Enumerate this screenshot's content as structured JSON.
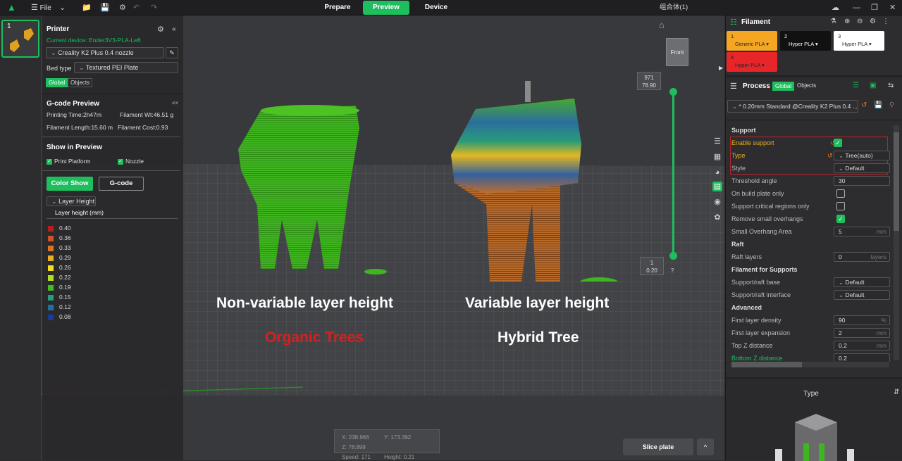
{
  "topbar": {
    "file_label": "File",
    "tabs": [
      {
        "label": "Prepare",
        "active": false
      },
      {
        "label": "Preview",
        "active": true
      },
      {
        "label": "Device",
        "active": false
      }
    ],
    "project_title": "组合体(1)"
  },
  "plate_thumb": {
    "index": "1"
  },
  "printer": {
    "title": "Printer",
    "current_device": "Current device: Ender3V3-PLA-Left",
    "printer_name": "Creality K2 Plus 0.4 nozzle",
    "bed_type_label": "Bed type",
    "bed_type_value": "Textured PEI Plate",
    "scope_global": "Global",
    "scope_objects": "Objects"
  },
  "gcode_preview": {
    "title": "G-code Preview",
    "printing_time": "Printing Time:2h47m",
    "filament_wt": "Filament Wt:46.51 g",
    "filament_length": "Filament Length:15.60 m",
    "filament_cost": "Filament Cost:0.93"
  },
  "show_in_preview": {
    "title": "Show in Preview",
    "print_platform": "Print Platform",
    "nozzle": "Nozzle",
    "color_show": "Color Show",
    "gcode": "G-code"
  },
  "legend": {
    "dropdown": "Layer Height",
    "header": "Layer height (mm)",
    "items": [
      {
        "value": "0.40",
        "color": "#b22020"
      },
      {
        "value": "0.36",
        "color": "#d0502a"
      },
      {
        "value": "0.33",
        "color": "#d8742a"
      },
      {
        "value": "0.29",
        "color": "#e8b020"
      },
      {
        "value": "0.26",
        "color": "#f0e020"
      },
      {
        "value": "0.22",
        "color": "#b0e020"
      },
      {
        "value": "0.19",
        "color": "#40c020"
      },
      {
        "value": "0.15",
        "color": "#20a080"
      },
      {
        "value": "0.12",
        "color": "#2070a8"
      },
      {
        "value": "0.08",
        "color": "#1a3aa0"
      }
    ]
  },
  "viewport": {
    "label_left": "Non-variable layer height",
    "label_left_sub": "Organic Trees",
    "label_right": "Variable layer height",
    "label_right_sub": "Hybrid Tree",
    "view_cube": "Front",
    "slider_top_layer": "971",
    "slider_top_height": "78.90",
    "slider_bottom_layer": "1",
    "slider_bottom_height": "0.20",
    "slider_help": "?",
    "coords": {
      "x": "X: 238.966",
      "y": "Y: 173.392",
      "z": "Z: 78.899",
      "speed_label": "Speed:",
      "speed": "171",
      "height_label": "Height:",
      "height": "0.21"
    },
    "slice_button": "Slice plate",
    "slice_caret": "^"
  },
  "filament": {
    "title": "Filament",
    "tiles": [
      {
        "num": "1",
        "name": "Generic PLA",
        "color": "#f5a623",
        "text": "#222"
      },
      {
        "num": "2",
        "name": "Hyper PLA",
        "color": "#111111",
        "text": "#fff"
      },
      {
        "num": "3",
        "name": "Hyper PLA",
        "color": "#ffffff",
        "text": "#222"
      },
      {
        "num": "4",
        "name": "Hyper PLA",
        "color": "#e8262a",
        "text": "#222"
      }
    ]
  },
  "process": {
    "title": "Process",
    "global": "Global",
    "objects": "Objects",
    "preset": "* 0.20mm Standard @Creality K2 Plus 0.4 ..."
  },
  "settings": {
    "support_header": "Support",
    "enable_support": "Enable support",
    "type_label": "Type",
    "type_value": "Tree(auto)",
    "style_label": "Style",
    "style_value": "Default",
    "threshold_label": "Threshold angle",
    "threshold_value": "30",
    "build_plate_only": "On build plate only",
    "critical_regions": "Support critical regions only",
    "remove_overhangs": "Remove small overhangs",
    "small_overhang_label": "Small Overhang Area",
    "small_overhang_value": "5",
    "small_overhang_unit": "mm",
    "raft_header": "Raft",
    "raft_layers_label": "Raft layers",
    "raft_layers_value": "0",
    "raft_layers_unit": "layers",
    "filament_supports_header": "Filament for Supports",
    "raft_base_label": "Support/raft base",
    "raft_base_value": "Default",
    "raft_interface_label": "Support/raft interface",
    "raft_interface_value": "Default",
    "advanced_header": "Advanced",
    "first_density_label": "First layer density",
    "first_density_value": "90",
    "first_density_unit": "%",
    "first_expansion_label": "First layer expansion",
    "first_expansion_value": "2",
    "first_expansion_unit": "mm",
    "top_z_label": "Top Z distance",
    "top_z_value": "0.2",
    "top_z_unit": "mm",
    "bottom_z_label": "Bottom Z distance",
    "bottom_z_value": "0.2"
  },
  "type_preview": {
    "title": "Type"
  }
}
